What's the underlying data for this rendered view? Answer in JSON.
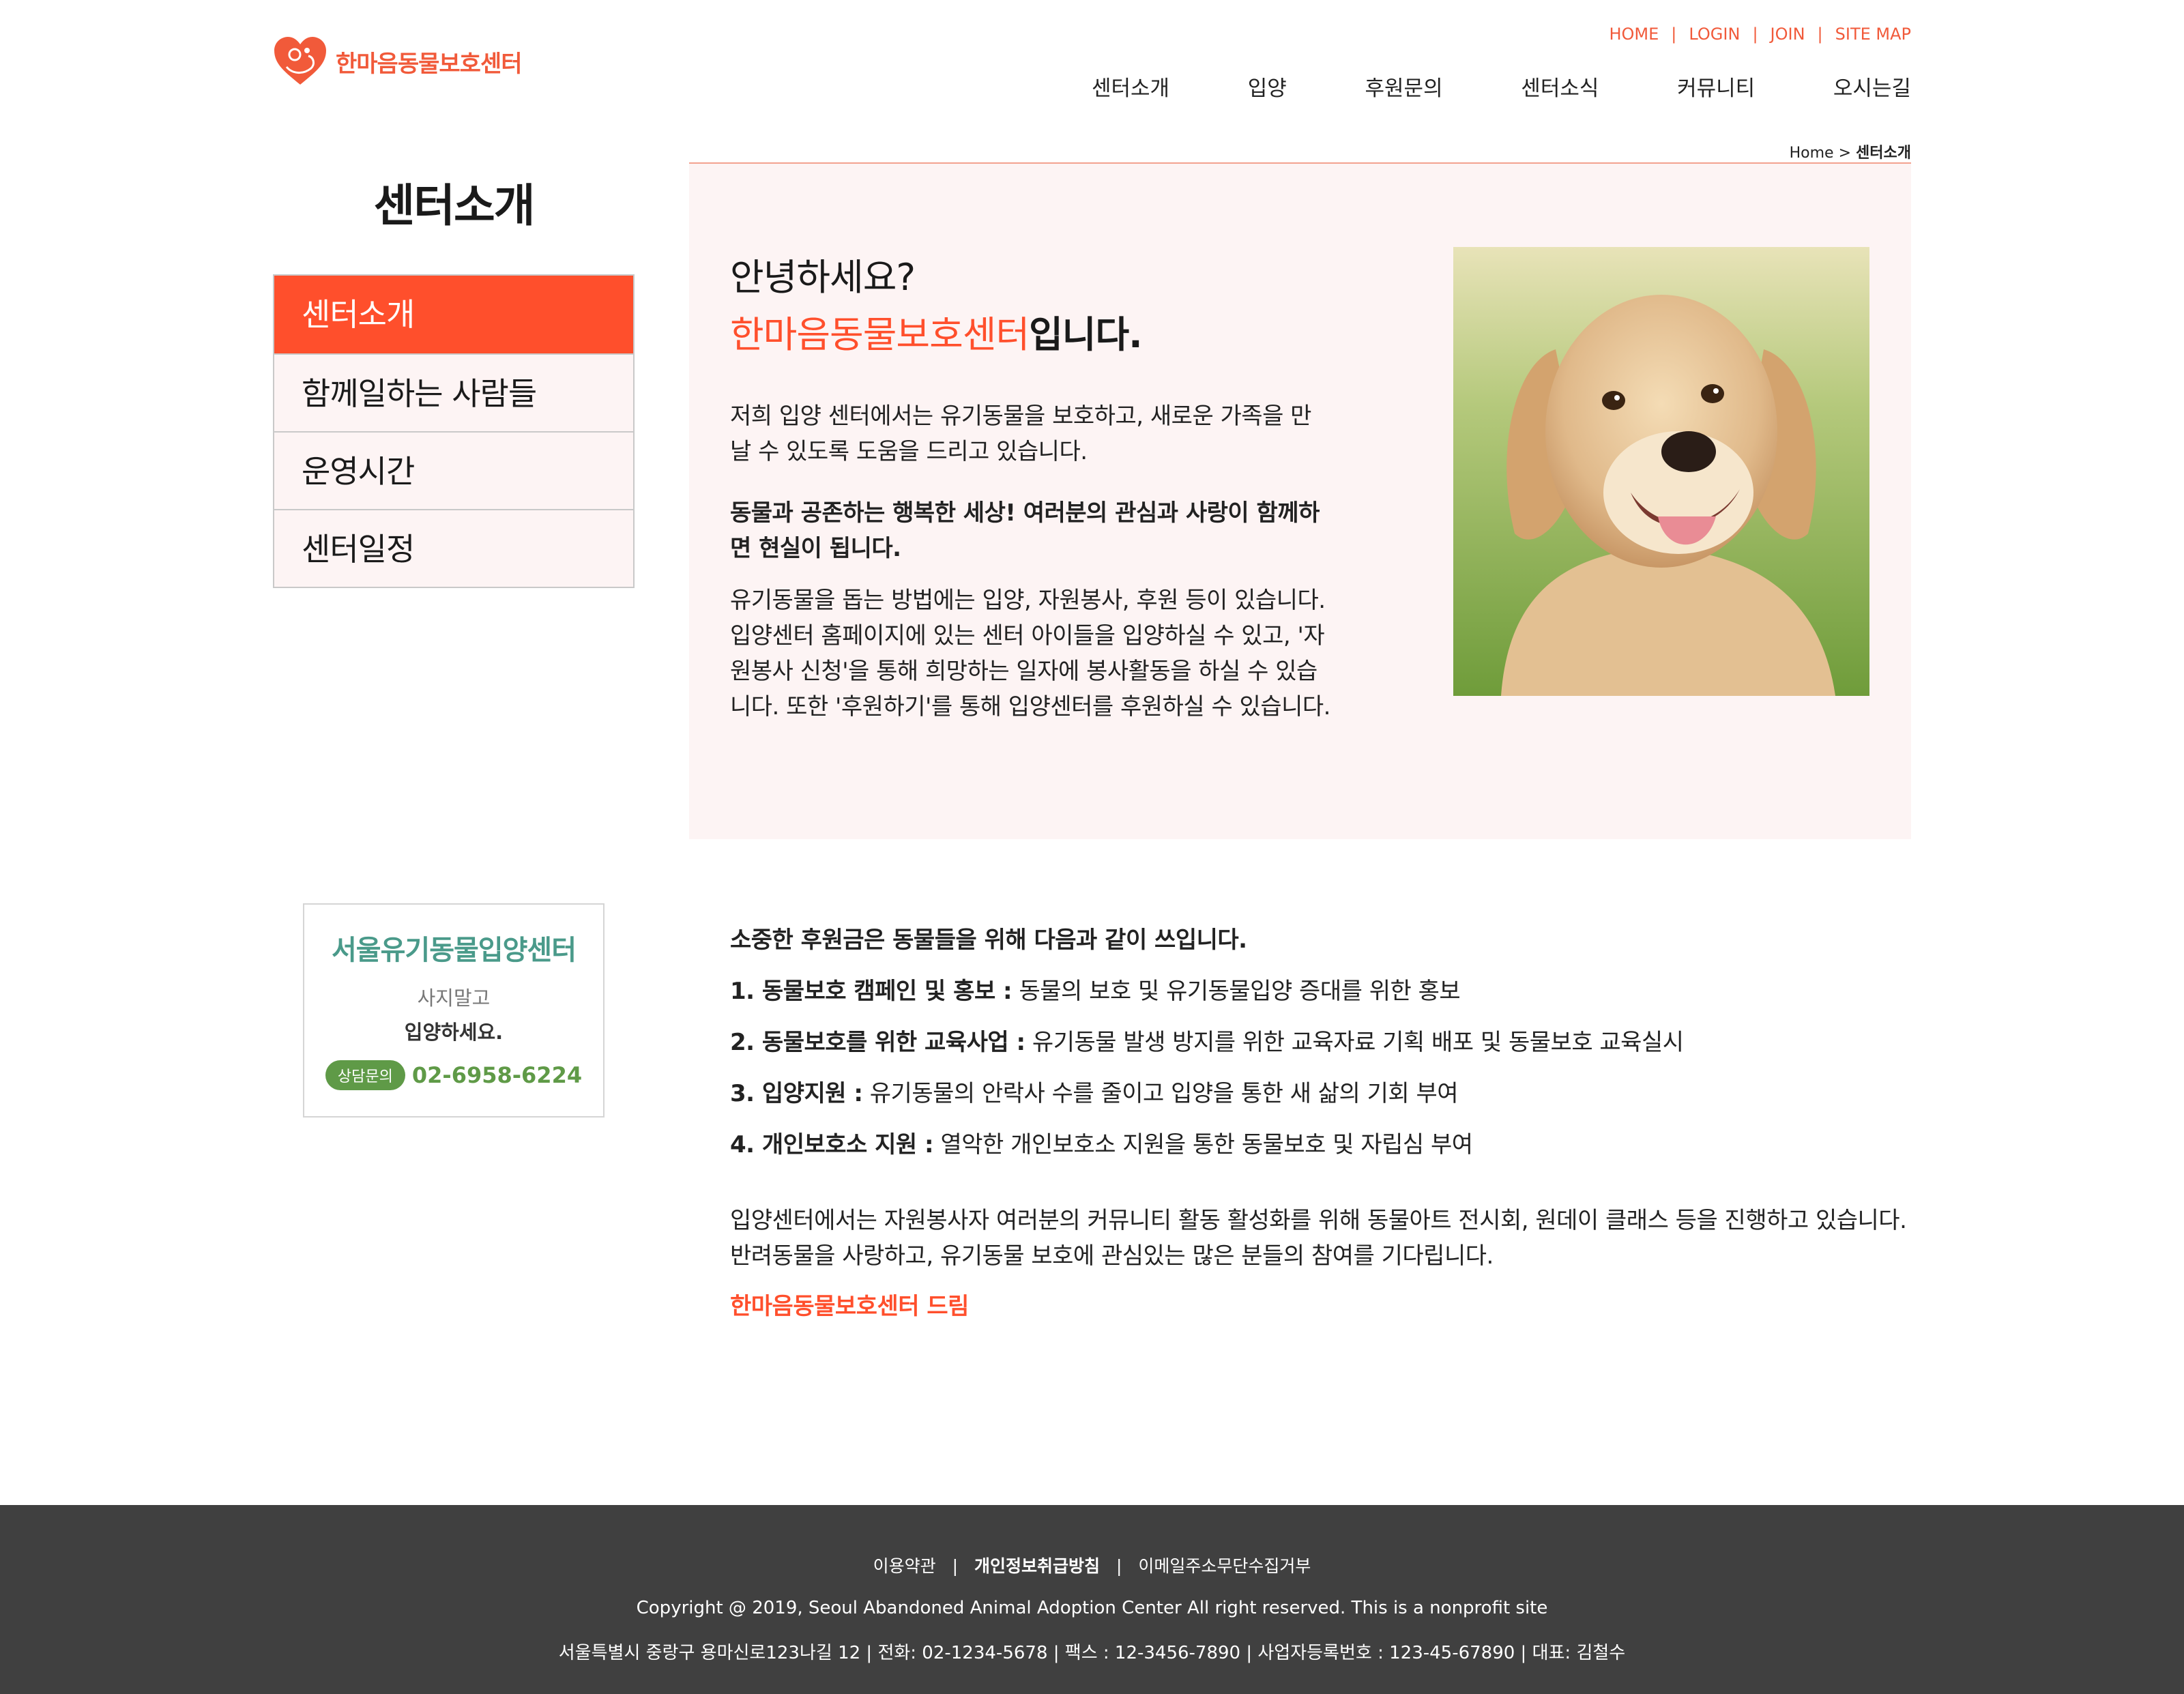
{
  "header": {
    "logo_text": "한마음동물보호센터",
    "top_links": [
      "HOME",
      "LOGIN",
      "JOIN",
      "SITE MAP"
    ],
    "gnb": [
      "센터소개",
      "입양",
      "후원문의",
      "센터소식",
      "커뮤니티",
      "오시는길"
    ]
  },
  "breadcrumb": {
    "home": "Home",
    "sep": ">",
    "current": "센터소개"
  },
  "sidebar": {
    "title": "센터소개",
    "items": [
      "센터소개",
      "함께일하는 사람들",
      "운영시간",
      "센터일정"
    ],
    "active_index": 0
  },
  "intro": {
    "greeting": "안녕하세요?",
    "center_name": "한마음동물보호센터",
    "center_suffix": "입니다.",
    "p1": "저희 입양 센터에서는 유기동물을 보호하고, 새로운 가족을 만날 수 있도록 도움을 드리고 있습니다.",
    "p2": "동물과 공존하는 행복한 세상! 여러분의 관심과 사랑이 함께하면 현실이 됩니다.",
    "p3": "유기동물을 돕는 방법에는 입양, 자원봉사, 후원 등이 있습니다. 입양센터 홈페이지에 있는 센터 아이들을 입양하실 수 있고, '자원봉사 신청'을 통해 희망하는 일자에 봉사활동을 하실 수 있습니다. 또한 '후원하기'를 통해 입양센터를 후원하실 수 있습니다."
  },
  "banner": {
    "title": "서울유기동물입양센터",
    "sub1": "사지말고",
    "sub2": "입양하세요.",
    "consult_label": "상담문의",
    "phone": "02-6958-6224"
  },
  "usage": {
    "heading": "소중한 후원금은 동물들을 위해 다음과 같이 쓰입니다.",
    "items": [
      {
        "title": "1. 동물보호 캠페인 및 홍보 :",
        "desc": " 동물의 보호 및 유기동물입양 증대를 위한 홍보"
      },
      {
        "title": "2. 동물보호를 위한 교육사업 :",
        "desc": " 유기동물 발생 방지를 위한 교육자료 기획 배포 및 동물보호 교육실시"
      },
      {
        "title": "3. 입양지원 :",
        "desc": " 유기동물의 안락사 수를 줄이고 입양을 통한 새 삶의 기회 부여"
      },
      {
        "title": "4. 개인보호소 지원 :",
        "desc": " 열악한 개인보호소 지원을 통한 동물보호 및 자립심 부여"
      }
    ],
    "closing": "입양센터에서는 자원봉사자 여러분의 커뮤니티 활동 활성화를 위해 동물아트 전시회, 원데이 클래스 등을 진행하고 있습니다. 반려동물을 사랑하고, 유기동물 보호에 관심있는 많은 분들의 참여를 기다립니다.",
    "sign": "한마음동물보호센터 드림"
  },
  "footer": {
    "links": [
      "이용약관",
      "개인정보취급방침",
      "이메일주소무단수집거부"
    ],
    "copyright": "Copyright @ 2019, Seoul Abandoned Animal Adoption Center All right reserved. This is a nonprofit site",
    "info": "서울특별시 중랑구 용마신로123나길 12 |   전화: 02-1234-5678 | 팩스 : 12-3456-7890 | 사업자등록번호 : 123-45-67890 |  대표: 김철수"
  },
  "colors": {
    "accent": "#ff4f2c",
    "logo": "#f15a3a",
    "intro_bg": "#fdf4f4",
    "banner_green": "#5f9a47",
    "banner_title": "#4a9a8a",
    "footer_bg": "#404040"
  }
}
